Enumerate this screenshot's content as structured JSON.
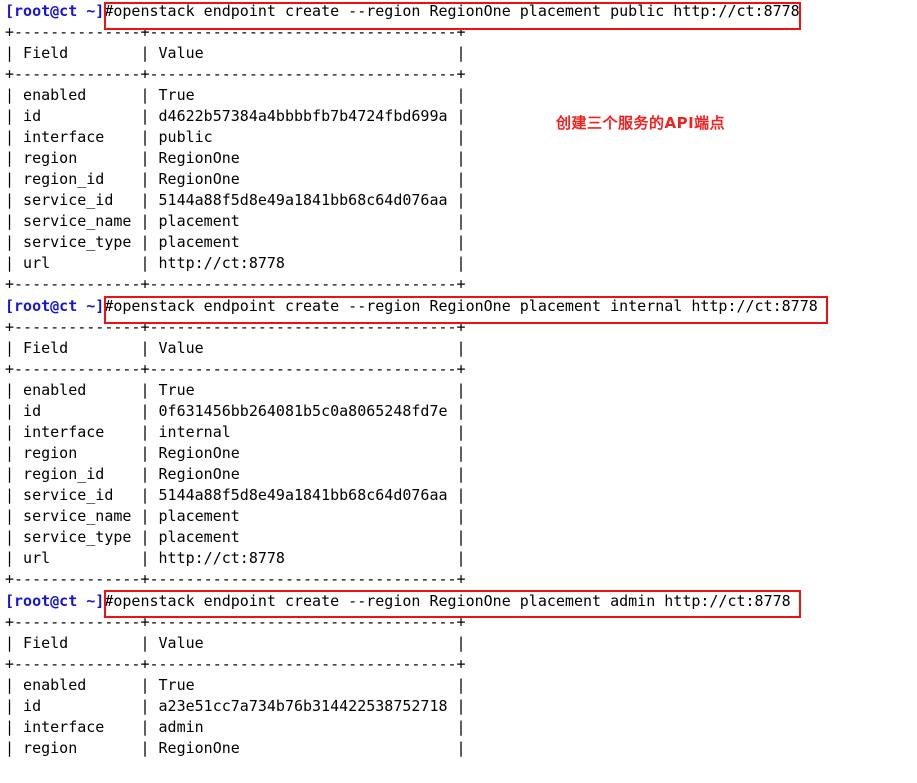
{
  "terminal": {
    "prompt": "[root@ct ~]",
    "hash": "#",
    "annotation": "创建三个服务的API端点",
    "colors": {
      "prompt": "#1414d6",
      "text": "#000000",
      "highlight": "#ee1111",
      "background": "#ffffff"
    },
    "blocks": [
      {
        "command": "openstack endpoint create --region RegionOne placement public http://ct:8778",
        "rule_top": "+--------------+----------------------------------+",
        "header": "| Field        | Value                            |",
        "rule_mid": "+--------------+----------------------------------+",
        "rows": [
          "| enabled      | True                             |",
          "| id           | d4622b57384a4bbbbfb7b4724fbd699a |",
          "| interface    | public                           |",
          "| region       | RegionOne                        |",
          "| region_id    | RegionOne                        |",
          "| service_id   | 5144a88f5d8e49a1841bb68c64d076aa |",
          "| service_name | placement                        |",
          "| service_type | placement                        |",
          "| url          | http://ct:8778                   |"
        ],
        "rule_bottom": "+--------------+----------------------------------+"
      },
      {
        "command": "openstack endpoint create --region RegionOne placement internal http://ct:8778",
        "rule_top": "+--------------+----------------------------------+",
        "header": "| Field        | Value                            |",
        "rule_mid": "+--------------+----------------------------------+",
        "rows": [
          "| enabled      | True                             |",
          "| id           | 0f631456bb264081b5c0a8065248fd7e |",
          "| interface    | internal                         |",
          "| region       | RegionOne                        |",
          "| region_id    | RegionOne                        |",
          "| service_id   | 5144a88f5d8e49a1841bb68c64d076aa |",
          "| service_name | placement                        |",
          "| service_type | placement                        |",
          "| url          | http://ct:8778                   |"
        ],
        "rule_bottom": "+--------------+----------------------------------+"
      },
      {
        "command": "openstack endpoint create --region RegionOne placement admin http://ct:8778",
        "rule_top": "+--------------+----------------------------------+",
        "header": "| Field        | Value                            |",
        "rule_mid": "+--------------+----------------------------------+",
        "rows": [
          "| enabled      | True                             |",
          "| id           | a23e51cc7a734b76b314422538752718 |",
          "| interface    | admin                            |",
          "| region       | RegionOne                        |"
        ],
        "rule_bottom": ""
      }
    ]
  }
}
